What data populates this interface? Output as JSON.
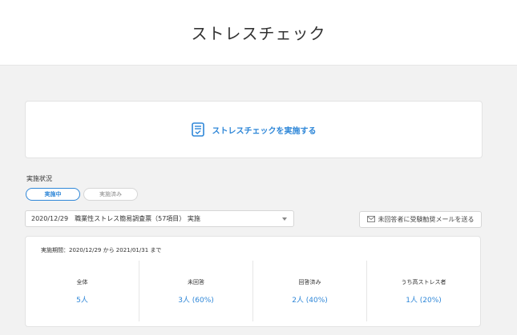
{
  "header": {
    "title": "ストレスチェック"
  },
  "cta": {
    "label": "ストレスチェックを実施する",
    "icon": "clipboard-check-icon"
  },
  "status": {
    "label": "実施状況",
    "tabs": [
      {
        "label": "実施中",
        "active": true
      },
      {
        "label": "実施済み",
        "active": false
      }
    ]
  },
  "select": {
    "value": "2020/12/29　職業性ストレス簡易調査票（57項目） 実施"
  },
  "mail_button": {
    "label": "未回答者に受験勧奨メールを送る",
    "icon": "mail-icon"
  },
  "summary": {
    "period": "実施期間：2020/12/29 から 2021/01/31 まで",
    "stats": [
      {
        "label": "全体",
        "value": "5人"
      },
      {
        "label": "未回答",
        "value": "3人 (60%)"
      },
      {
        "label": "回答済み",
        "value": "2人 (40%)"
      },
      {
        "label": "うち高ストレス者",
        "value": "1人 (20%)"
      }
    ]
  },
  "colors": {
    "accent": "#2f87d8",
    "background": "#f2f2f2"
  }
}
